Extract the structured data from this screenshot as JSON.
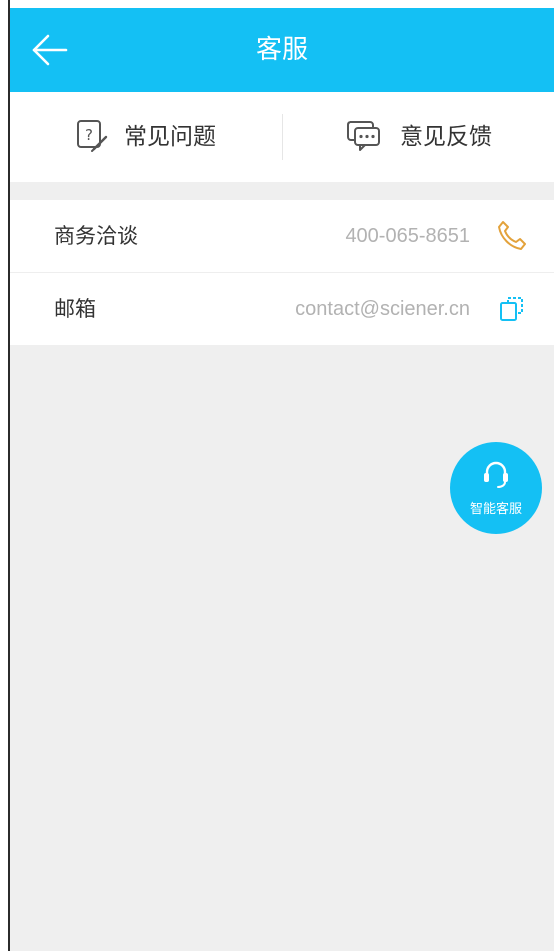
{
  "header": {
    "title": "客服",
    "back_icon": "back-arrow-icon",
    "color": "#14c0f4"
  },
  "tabs": [
    {
      "label": "常见问题",
      "icon": "faq-icon"
    },
    {
      "label": "意见反馈",
      "icon": "feedback-chat-icon"
    }
  ],
  "contacts": [
    {
      "label": "商务洽谈",
      "value": "400-065-8651",
      "icon": "phone-icon",
      "icon_color": "#e3a23b"
    },
    {
      "label": "邮箱",
      "value": "contact@sciener.cn",
      "icon": "copy-icon",
      "icon_color": "#14c0f4"
    }
  ],
  "fab": {
    "label": "智能客服",
    "icon": "headset-icon"
  }
}
